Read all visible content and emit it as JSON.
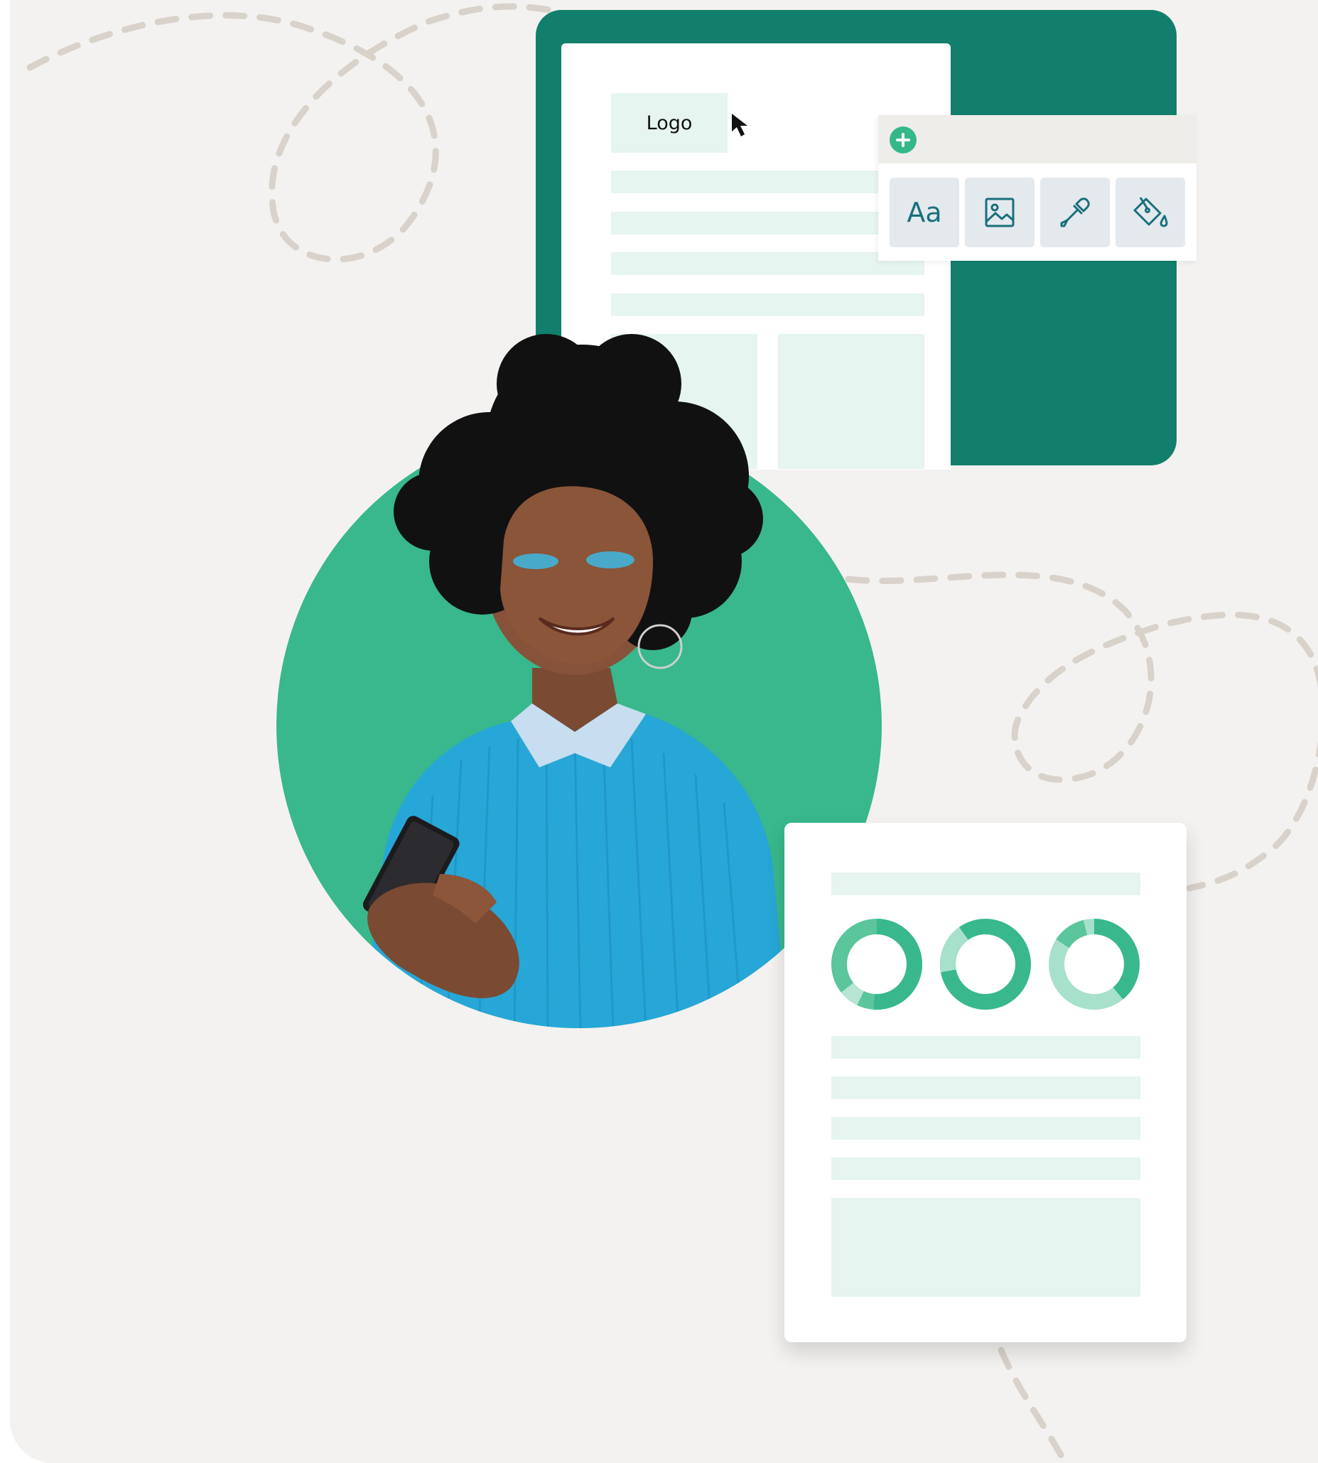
{
  "editor": {
    "logo_label": "Logo"
  },
  "toolbar": {
    "tools": [
      {
        "label": "Aa",
        "icon": "text-icon"
      },
      {
        "icon": "image-icon"
      },
      {
        "icon": "eyedropper-icon"
      },
      {
        "icon": "paint-bucket-icon"
      }
    ]
  },
  "report": {
    "donuts": [
      {
        "icon": "donut-chart-icon"
      },
      {
        "icon": "donut-chart-icon"
      },
      {
        "icon": "donut-chart-icon"
      }
    ]
  },
  "colors": {
    "brand_green": "#127f6c",
    "accent_green": "#38b88c",
    "light_green": "#e6f5ef",
    "background": "#f4f2f0",
    "dash": "#d8d2ca"
  }
}
